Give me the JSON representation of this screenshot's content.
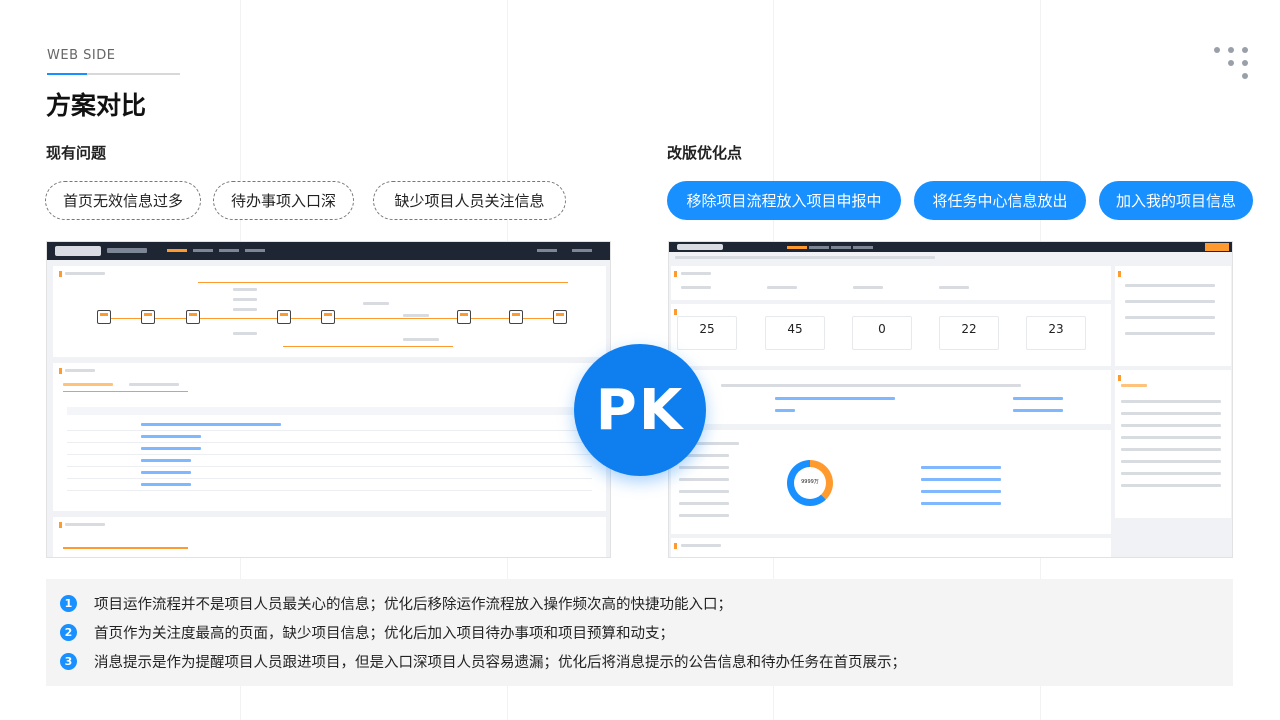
{
  "header": {
    "eyebrow": "WEB SIDE",
    "title": "方案对比"
  },
  "left": {
    "heading": "现有问题",
    "tags": [
      "首页无效信息过多",
      "待办事项入口深",
      "缺少项目人员关注信息"
    ]
  },
  "right": {
    "heading": "改版优化点",
    "tags": [
      "移除项目流程放入项目申报中",
      "将任务中心信息放出",
      "加入我的项目信息"
    ]
  },
  "badge": {
    "label": "PK"
  },
  "notes": [
    {
      "num": "1",
      "text": "项目运作流程并不是项目人员最关心的信息；优化后移除运作流程放入操作频次高的快捷功能入口；"
    },
    {
      "num": "2",
      "text": "首页作为关注度最高的页面，缺少项目信息；优化后加入项目待办事项和项目预算和动支；"
    },
    {
      "num": "3",
      "text": "消息提示是作为提醒项目人员跟进项目，但是入口深项目人员容易遗漏；优化后将消息提示的公告信息和待办任务在首页展示；"
    }
  ],
  "old_screen": {
    "image_label": "旧版首页截图"
  },
  "new_screen": {
    "image_label": "新版首页截图",
    "stats": [
      "25",
      "45",
      "0",
      "22",
      "23"
    ],
    "budget_total": "9999万"
  },
  "colors": {
    "accent": "#1890ff",
    "badge": "#0f7ff0",
    "screen_topbar": "#1f2633",
    "screen_highlight": "#ff9a2e"
  }
}
